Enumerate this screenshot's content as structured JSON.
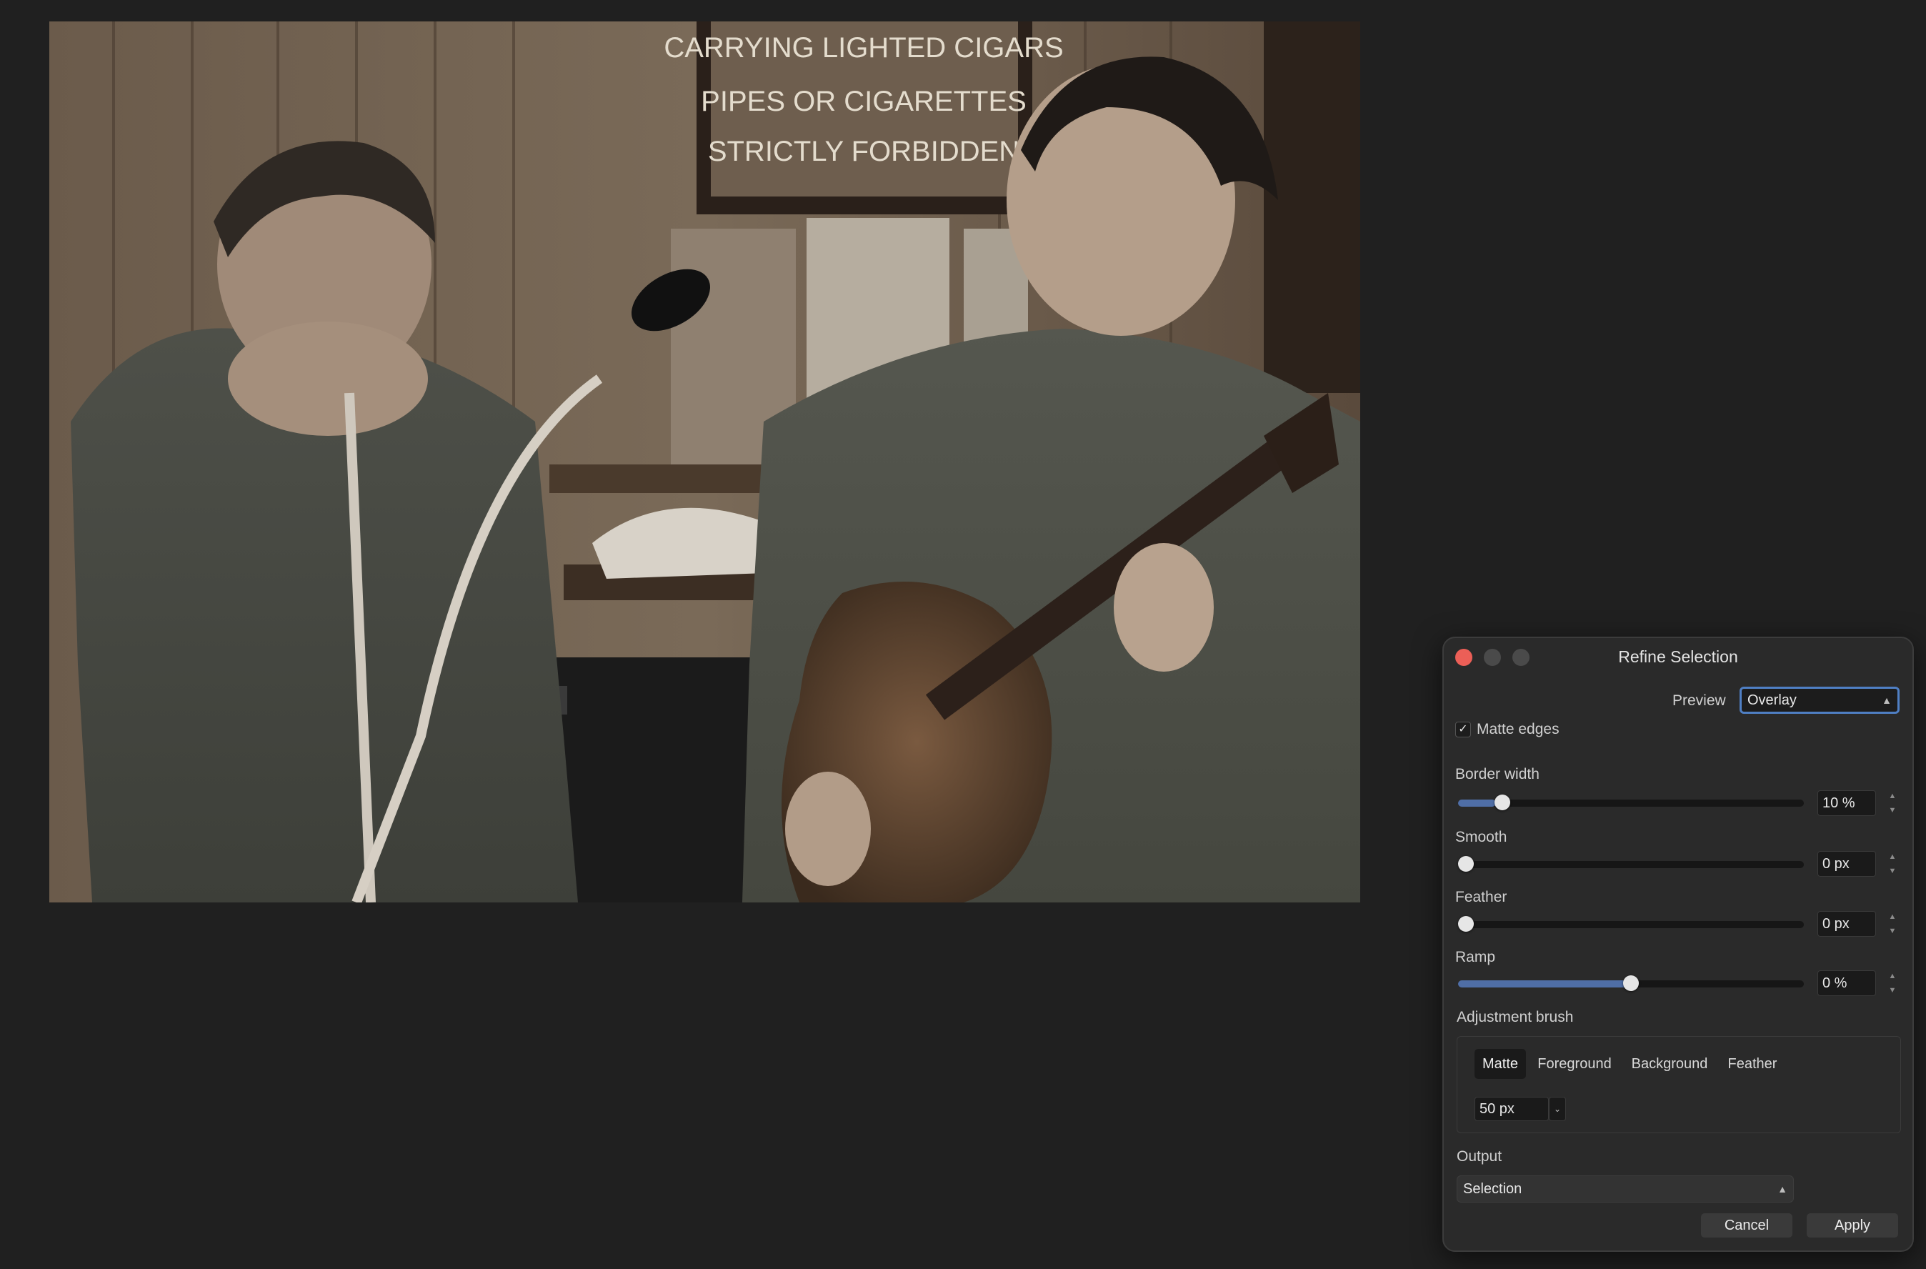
{
  "panel": {
    "title": "Refine Selection",
    "preview_label": "Preview",
    "preview_value": "Overlay",
    "matte_edges_label": "Matte edges",
    "matte_edges_checked": true,
    "border_width": {
      "label": "Border width",
      "value": "10 %",
      "level": 0.11
    },
    "smooth": {
      "label": "Smooth",
      "value": "0 px",
      "level": 0
    },
    "feather": {
      "label": "Feather",
      "value": "0 px",
      "level": 0
    },
    "ramp": {
      "label": "Ramp",
      "value": "0 %",
      "level": 0.5
    },
    "adjustment_brush": {
      "label": "Adjustment brush",
      "modes": [
        "Matte",
        "Foreground",
        "Background",
        "Feather"
      ],
      "active_mode": "Matte",
      "size": "50 px"
    },
    "output": {
      "label": "Output",
      "value": "Selection"
    },
    "cancel_label": "Cancel",
    "apply_label": "Apply"
  },
  "photo": {
    "sign_lines": [
      "CARRYING LIGHTED CIGARS",
      "PIPES OR CIGARETTES",
      "STRICTLY FORBIDDEN"
    ]
  },
  "colors": {
    "accent": "#4f7fc4",
    "slider_fill": "#4f6ea6",
    "close_button": "#ec5f57",
    "background": "#202020",
    "panel": "#2a2a2a"
  }
}
